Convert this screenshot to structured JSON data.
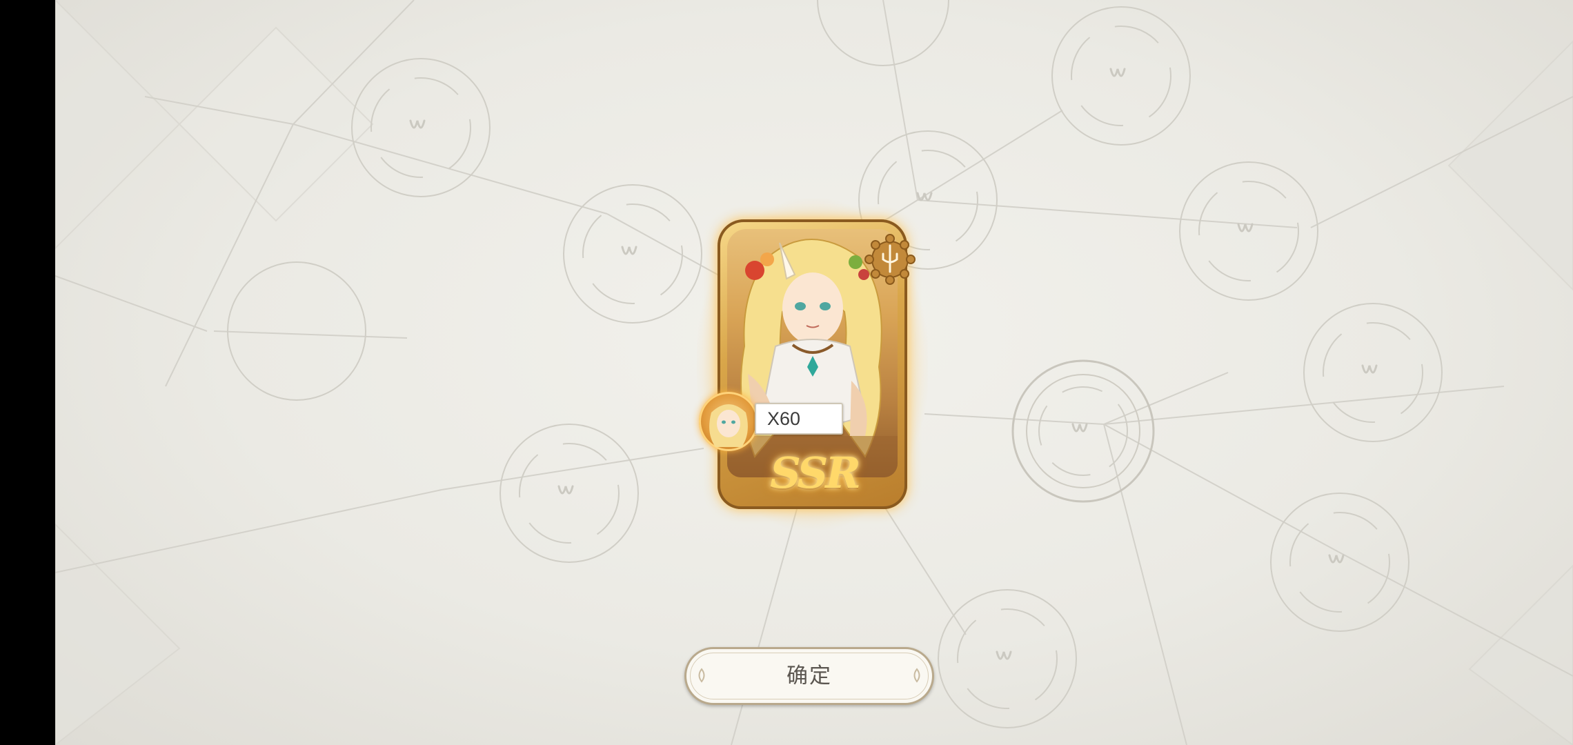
{
  "screen": {
    "title": "gacha-result"
  },
  "card": {
    "rarity": "SSR",
    "class_icon": "trident-class-icon",
    "glow_color": "#ffc850"
  },
  "reward": {
    "count_label": "X60",
    "icon": "character-portrait-token-icon"
  },
  "confirm_button": {
    "label": "确定"
  },
  "colors": {
    "background": "#ebeae4",
    "gold": "#d9a64a",
    "button_border": "#b9a98c",
    "button_text": "#5b5650"
  }
}
